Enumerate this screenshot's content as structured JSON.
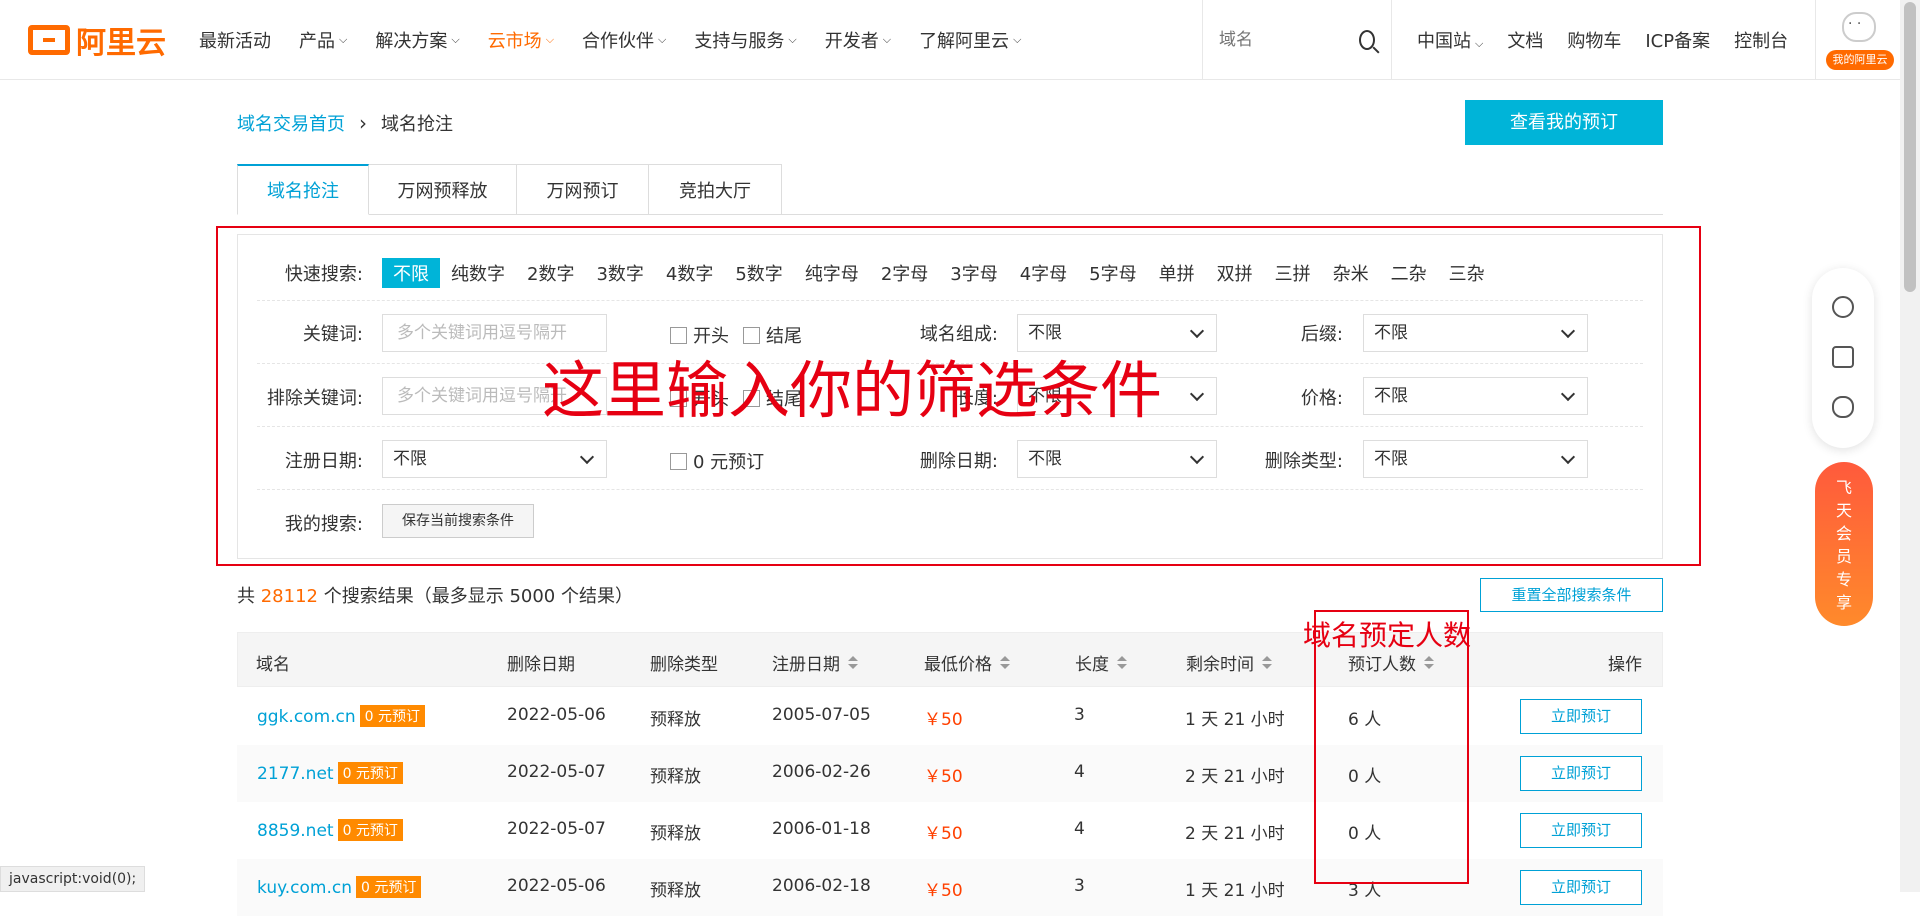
{
  "nav": {
    "logo_text": "阿里云",
    "items": [
      {
        "label": "最新活动",
        "caret": false,
        "active": false
      },
      {
        "label": "产品",
        "caret": true,
        "active": false
      },
      {
        "label": "解决方案",
        "caret": true,
        "active": false
      },
      {
        "label": "云市场",
        "caret": true,
        "active": true
      },
      {
        "label": "合作伙伴",
        "caret": true,
        "active": false
      },
      {
        "label": "支持与服务",
        "caret": true,
        "active": false
      },
      {
        "label": "开发者",
        "caret": true,
        "active": false
      },
      {
        "label": "了解阿里云",
        "caret": true,
        "active": false
      }
    ],
    "search_placeholder": "域名",
    "right_items": [
      "中国站",
      "文档",
      "购物车",
      "ICP备案",
      "控制台"
    ],
    "avatar_tag": "我的阿里云"
  },
  "breadcrumb": {
    "home": "域名交易首页",
    "current": "域名抢注"
  },
  "reserve_button": "查看我的预订",
  "tabs": [
    "域名抢注",
    "万网预释放",
    "万网预订",
    "竞拍大厅"
  ],
  "filters": {
    "quick_label": "快速搜索:",
    "quick_items": [
      "不限",
      "纯数字",
      "2数字",
      "3数字",
      "4数字",
      "5数字",
      "纯字母",
      "2字母",
      "3字母",
      "4字母",
      "5字母",
      "单拼",
      "双拼",
      "三拼",
      "杂米",
      "二杂",
      "三杂"
    ],
    "keyword_label": "关键词:",
    "keyword_placeholder": "多个关键词用逗号隔开",
    "start_label": "开头",
    "end_label": "结尾",
    "composition_label": "域名组成:",
    "composition_value": "不限",
    "suffix_label": "后缀:",
    "suffix_value": "不限",
    "exclude_label": "排除关键词:",
    "exclude_placeholder": "多个关键词用逗号隔开",
    "exclude_start": "开头",
    "exclude_end": "结尾",
    "length_label": "长度:",
    "length_value": "不限",
    "price_label": "价格:",
    "price_value": "不限",
    "regdate_label": "注册日期:",
    "regdate_value": "不限",
    "zero_label": "0 元预订",
    "deldate_label": "删除日期:",
    "deldate_value": "不限",
    "deltype_label": "删除类型:",
    "deltype_value": "不限",
    "mysearch_label": "我的搜索:",
    "save_button": "保存当前搜索条件"
  },
  "annotation_main": "这里输入你的筛选条件",
  "annotation_small": "域名预定人数",
  "results": {
    "prefix": "共",
    "count": "28112",
    "suffix": "个搜索结果（最多显示 5000 个结果）",
    "reset_button": "重置全部搜索条件"
  },
  "table": {
    "headers": [
      "域名",
      "删除日期",
      "删除类型",
      "注册日期",
      "最低价格",
      "长度",
      "剩余时间",
      "预订人数",
      "操作"
    ],
    "rows": [
      {
        "domain": "ggk.com.cn",
        "tag": "0 元预订",
        "deldate": "2022-05-06",
        "deltype": "预释放",
        "regdate": "2005-07-05",
        "price": "￥50",
        "length": "3",
        "remain": "1 天 21 小时",
        "count": "6 人",
        "action": "立即预订"
      },
      {
        "domain": "2177.net",
        "tag": "0 元预订",
        "deldate": "2022-05-07",
        "deltype": "预释放",
        "regdate": "2006-02-26",
        "price": "￥50",
        "length": "4",
        "remain": "2 天 21 小时",
        "count": "0 人",
        "action": "立即预订"
      },
      {
        "domain": "8859.net",
        "tag": "0 元预订",
        "deldate": "2022-05-07",
        "deltype": "预释放",
        "regdate": "2006-01-18",
        "price": "￥50",
        "length": "4",
        "remain": "2 天 21 小时",
        "count": "0 人",
        "action": "立即预订"
      },
      {
        "domain": "kuy.com.cn",
        "tag": "0 元预订",
        "deldate": "2022-05-06",
        "deltype": "预释放",
        "regdate": "2006-02-18",
        "price": "￥50",
        "length": "3",
        "remain": "1 天 21 小时",
        "count": "3 人",
        "action": "立即预订"
      }
    ]
  },
  "side": {
    "vip_text": "飞天会员专享",
    "icons": [
      "headset-icon",
      "phone-icon",
      "cloud-icon"
    ]
  },
  "status_bar": "javascript:void(0);",
  "colors": {
    "accent": "#00a1d6",
    "brand": "#ff6a00",
    "annotation": "#e60012"
  }
}
